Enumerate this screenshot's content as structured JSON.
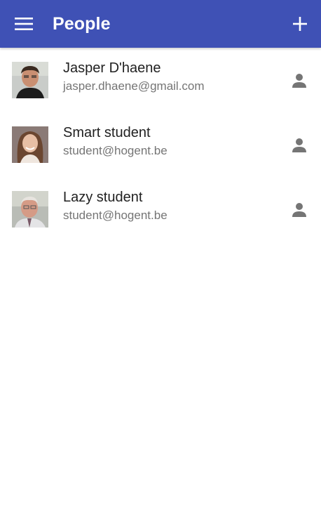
{
  "appbar": {
    "title": "People",
    "menu_icon": "menu-icon",
    "add_icon": "add-icon",
    "color": "#3F51B5"
  },
  "people": [
    {
      "name": "Jasper D'haene",
      "email": "jasper.dhaene@gmail.com",
      "action_icon": "person-icon"
    },
    {
      "name": "Smart student",
      "email": "student@hogent.be",
      "action_icon": "person-icon"
    },
    {
      "name": "Lazy student",
      "email": "student@hogent.be",
      "action_icon": "person-icon"
    }
  ]
}
